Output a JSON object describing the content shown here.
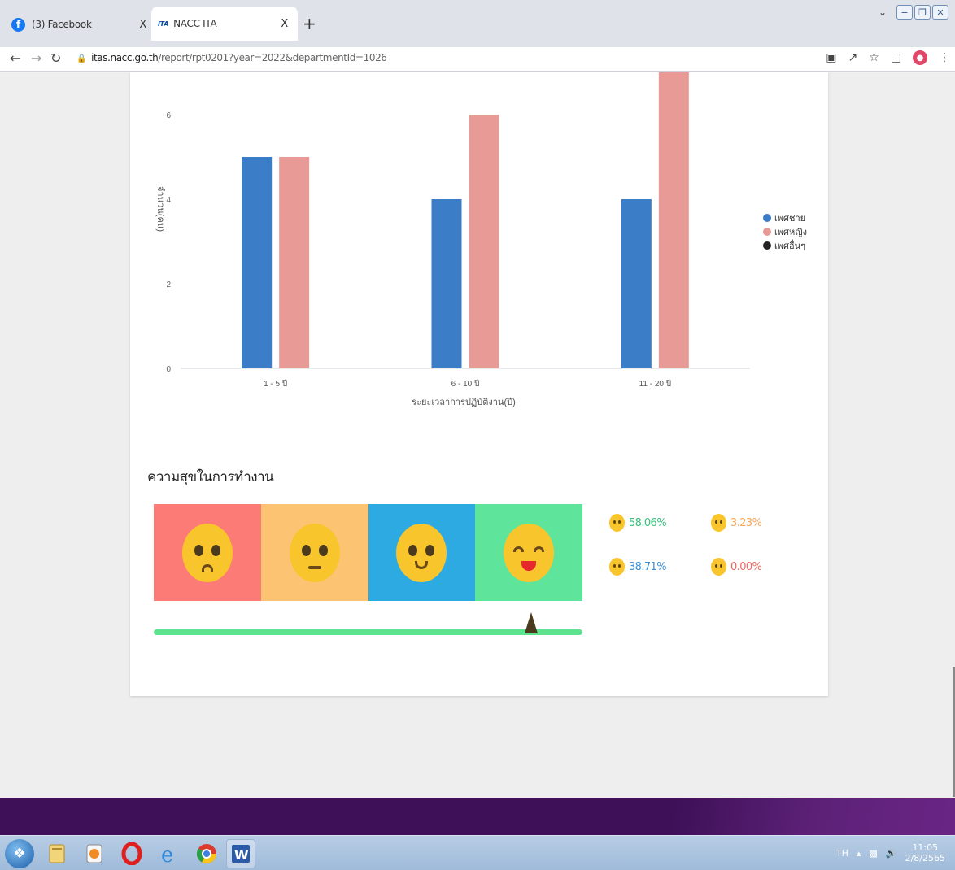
{
  "browser": {
    "tabs": [
      {
        "label": "(3) Facebook",
        "close": "X"
      },
      {
        "label": "NACC ITA",
        "close": "X"
      }
    ],
    "new_tab": "+",
    "url_host": "itas.nacc.go.th",
    "url_path": "/report/rpt0201?year=2022&departmentId=1026"
  },
  "chart_data": {
    "type": "bar",
    "categories": [
      "1 - 5 ปี",
      "6 - 10 ปี",
      "11 - 20 ปี"
    ],
    "series": [
      {
        "name": "เพศชาย",
        "color": "#3b7dc6",
        "values": [
          5,
          4,
          4
        ]
      },
      {
        "name": "เพศหญิง",
        "color": "#e89a97",
        "values": [
          5,
          6,
          7
        ]
      },
      {
        "name": "เพศอื่นๆ",
        "color": "#222222",
        "values": [
          0,
          0,
          0
        ]
      }
    ],
    "yticks": [
      "0",
      "2",
      "4",
      "6"
    ],
    "ylim": [
      0,
      7
    ],
    "xlabel": "ระยะเวลาการปฏิบัติงาน(ปี)",
    "ylabel": "จำนวน(คน)",
    "legend_position": "right"
  },
  "happiness": {
    "title": "ความสุขในการทำงาน",
    "face_colors": [
      "#fd7b76",
      "#fcc372",
      "#2daae2",
      "#5ee59b"
    ],
    "meter_level": 0.88,
    "stats": [
      {
        "value": "58.06%",
        "color": "#3cc07a"
      },
      {
        "value": "3.23%",
        "color": "#f5a95c"
      },
      {
        "value": "38.71%",
        "color": "#3d8fd4"
      },
      {
        "value": "0.00%",
        "color": "#f06a64"
      }
    ]
  },
  "taskbar": {
    "lang": "TH",
    "time": "11:05",
    "date": "2/8/2565"
  }
}
